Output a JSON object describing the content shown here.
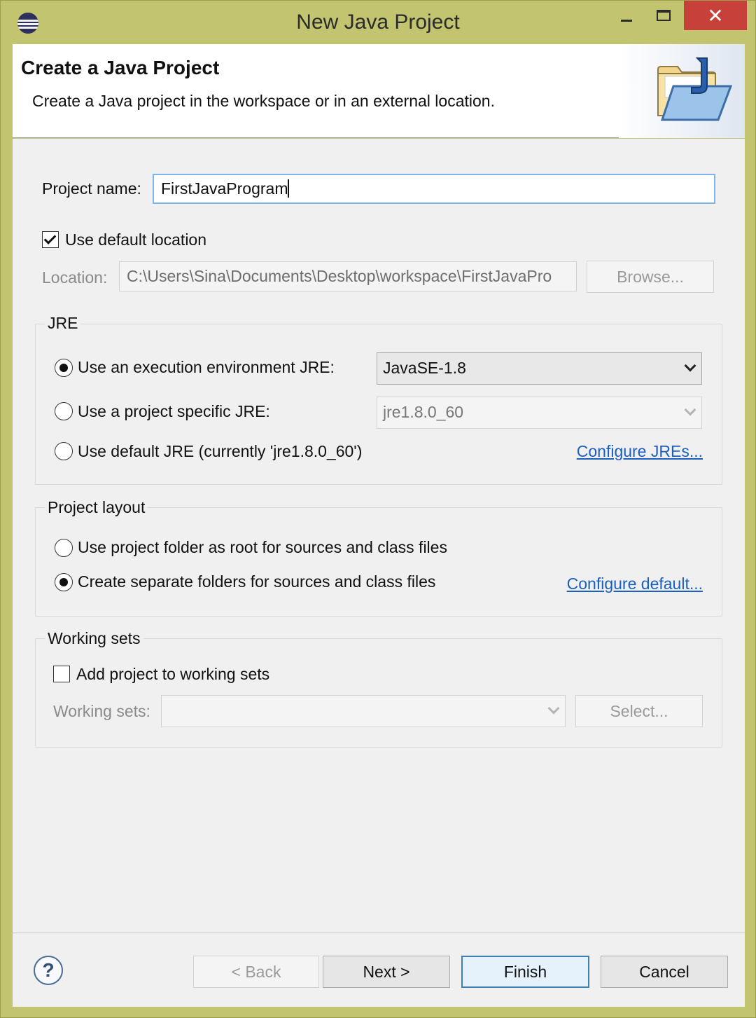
{
  "window": {
    "title": "New Java Project",
    "icons": {
      "app": "eclipse-icon",
      "minimize": "minimize-icon",
      "maximize": "maximize-icon",
      "close": "close-icon"
    },
    "close_glyph": "✕"
  },
  "header": {
    "title": "Create a Java Project",
    "description": "Create a Java project in the workspace or in an external location.",
    "icon": "java-project-folder-icon"
  },
  "project": {
    "name_label": "Project name:",
    "name_value": "FirstJavaProgram",
    "use_default_location_label": "Use default location",
    "use_default_location_checked": true,
    "location_label": "Location:",
    "location_value": "C:\\Users\\Sina\\Documents\\Desktop\\workspace\\FirstJavaPro",
    "browse_label": "Browse..."
  },
  "jre": {
    "group_title": "JRE",
    "options": [
      {
        "label": "Use an execution environment JRE:",
        "selected": true
      },
      {
        "label": "Use a project specific JRE:",
        "selected": false
      },
      {
        "label": "Use default JRE (currently 'jre1.8.0_60')",
        "selected": false
      }
    ],
    "execution_env_value": "JavaSE-1.8",
    "project_specific_value": "jre1.8.0_60",
    "configure_link": "Configure JREs..."
  },
  "layout": {
    "group_title": "Project layout",
    "options": [
      {
        "label": "Use project folder as root for sources and class files",
        "selected": false
      },
      {
        "label": "Create separate folders for sources and class files",
        "selected": true
      }
    ],
    "configure_link": "Configure default..."
  },
  "working_sets": {
    "group_title": "Working sets",
    "add_label": "Add project to working sets",
    "add_checked": false,
    "sets_label": "Working sets:",
    "sets_value": "",
    "select_label": "Select..."
  },
  "footer": {
    "help_glyph": "?",
    "back_label": "< Back",
    "next_label": "Next >",
    "finish_label": "Finish",
    "cancel_label": "Cancel"
  }
}
